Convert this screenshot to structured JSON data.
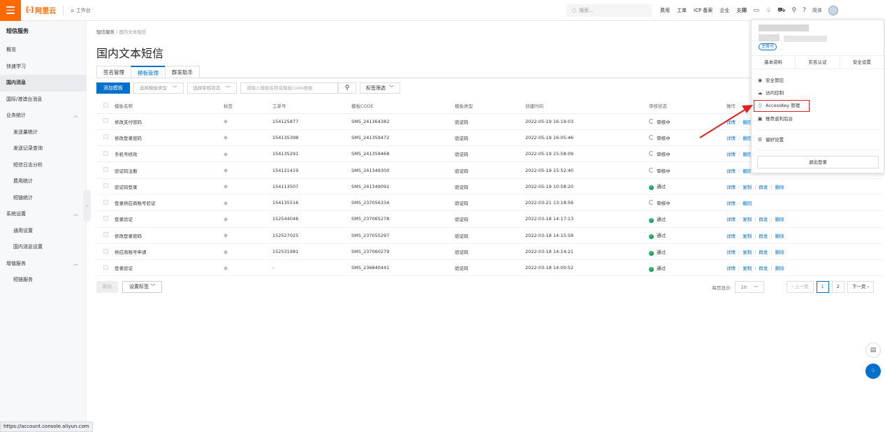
{
  "topbar": {
    "brand": "阿里云",
    "workbench": "工作台",
    "search_placeholder": "搜索...",
    "nav": [
      "费用",
      "工单",
      "ICP 备案",
      "企业",
      "支持"
    ],
    "lang": "简体"
  },
  "sidebar": {
    "title": "短信服务",
    "items": [
      {
        "label": "概览"
      },
      {
        "label": "快速学习"
      },
      {
        "label": "国内消息"
      },
      {
        "label": "国际/港澳台消息"
      },
      {
        "label": "业务统计"
      },
      {
        "label": "发送量统计"
      },
      {
        "label": "发送记录查询"
      },
      {
        "label": "短信日志分析"
      },
      {
        "label": "费用统计"
      },
      {
        "label": "短链统计"
      },
      {
        "label": "系统设置"
      },
      {
        "label": "通用设置"
      },
      {
        "label": "国内消息设置"
      },
      {
        "label": "增值服务"
      },
      {
        "label": "短链服务"
      }
    ]
  },
  "status_url": "https://account.console.aliyun.com",
  "breadcrumb": {
    "root": "短信服务",
    "sep": "/",
    "current": "国内文本短信"
  },
  "page_title": "国内文本短信",
  "tabs": [
    "签名管理",
    "模板管理",
    "群发助手"
  ],
  "filters": {
    "add_button": "添加模板",
    "type_select": "选择模板类型",
    "status_select": "选择审核状态",
    "search_placeholder": "请输入模板名称或模板Code搜索",
    "tag_filter": "标签筛选"
  },
  "table": {
    "headers": [
      "模板名称",
      "标签",
      "工单号",
      "模板CODE",
      "模板类型",
      "创建时间",
      "审核状态",
      "操作"
    ],
    "rows": [
      {
        "name": "修改支付密码",
        "ticket": "154125877",
        "code": "SMS_241364382",
        "type": "验证码",
        "time": "2022-05-19 16:19:03",
        "status": "审核中",
        "ops": [
          "详情",
          "撤回"
        ]
      },
      {
        "name": "修改登录密码",
        "ticket": "154135398",
        "code": "SMS_241359472",
        "type": "验证码",
        "time": "2022-05-19 16:05:46",
        "status": "审核中",
        "ops": [
          "详情",
          "撤回"
        ]
      },
      {
        "name": "手机号修改",
        "ticket": "154135291",
        "code": "SMS_241359468",
        "type": "验证码",
        "time": "2022-05-19 15:58:09",
        "status": "审核中",
        "ops": [
          "详情",
          "撤回"
        ]
      },
      {
        "name": "验证码注册",
        "ticket": "154121419",
        "code": "SMS_241349300",
        "type": "验证码",
        "time": "2022-05-19 15:52:40",
        "status": "审核中",
        "ops": [
          "详情",
          "撤回"
        ]
      },
      {
        "name": "验证码登录",
        "ticket": "154113507",
        "code": "SMS_241349091",
        "type": "验证码",
        "time": "2022-05-19 10:58:20",
        "status": "通过",
        "ops": [
          "详情",
          "复制",
          "群发",
          "删除"
        ]
      },
      {
        "name": "登录供应商账号验证",
        "ticket": "154135516",
        "code": "SMS_237056334",
        "type": "验证码",
        "time": "2022-03-21 13:18:56",
        "status": "审核中",
        "ops": [
          "详情",
          "撤回"
        ]
      },
      {
        "name": "登录验证",
        "ticket": "152544048",
        "code": "SMS_237065278",
        "type": "验证码",
        "time": "2022-03-18 14:17:13",
        "status": "通过",
        "ops": [
          "详情",
          "复制",
          "群发",
          "删除"
        ]
      },
      {
        "name": "修改登录密码",
        "ticket": "152527025",
        "code": "SMS_237055297",
        "type": "验证码",
        "time": "2022-03-18 14:15:58",
        "status": "通过",
        "ops": [
          "详情",
          "复制",
          "群发",
          "删除"
        ]
      },
      {
        "name": "供应商账号申请",
        "ticket": "152531981",
        "code": "SMS_237060279",
        "type": "验证码",
        "time": "2022-03-18 14:14:21",
        "status": "通过",
        "ops": [
          "详情",
          "复制",
          "群发",
          "删除"
        ]
      },
      {
        "name": "登录验证",
        "ticket": "-",
        "code": "SMS_236840441",
        "type": "验证码",
        "time": "2022-03-18 14:00:52",
        "status": "通过",
        "ops": [
          "详情",
          "复制",
          "群发",
          "删除"
        ]
      }
    ]
  },
  "bottom": {
    "delete": "删除",
    "set_tag": "设置标签"
  },
  "pager": {
    "per_page_label": "每页显示:",
    "per_page": "10",
    "prev": "上一页",
    "pages": [
      "1",
      "2"
    ],
    "next": "下一页"
  },
  "dropdown": {
    "badge": "主账号",
    "tabs": [
      "基本资料",
      "实名认证",
      "安全设置"
    ],
    "items": [
      "安全管控",
      "访问控制",
      "AccessKey 管理",
      "推荐返利后台",
      "偏好设置"
    ],
    "logout": "退出登录"
  },
  "colors": {
    "brand": "#ff6a00",
    "primary": "#0070cc",
    "success": "#1aa35d",
    "highlight": "#e02020"
  }
}
